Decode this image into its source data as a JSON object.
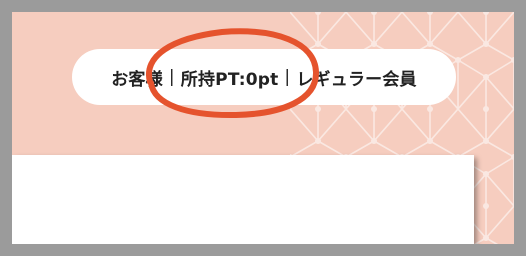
{
  "status_bar": {
    "customer_label": "お客様",
    "separator": "|",
    "points_label": "所持PT:0pt",
    "rank_label": "レギュラー会員"
  },
  "colors": {
    "background": "#f6cdbf",
    "outer_frame": "#9b9b9b",
    "highlight_circle": "#e5532d",
    "pill_background": "#ffffff"
  },
  "icons": [
    "asanoha-pattern",
    "highlight-circle"
  ]
}
